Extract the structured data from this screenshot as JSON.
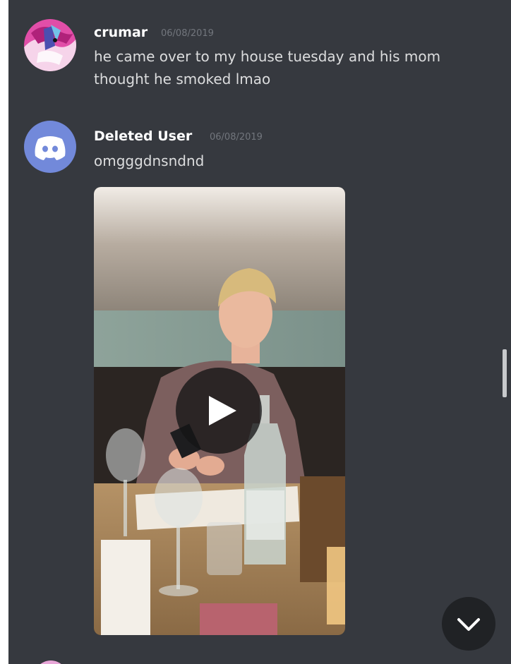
{
  "messages": [
    {
      "author": "crumar",
      "timestamp": "06/08/2019",
      "lines": [
        "he came over to my house tuesday and his mom",
        "thought he smoked lmao"
      ],
      "avatar": "artwork-avatar"
    },
    {
      "author": "Deleted User",
      "timestamp": "06/08/2019",
      "lines": [
        "omgggdnsndnd"
      ],
      "avatar": "discord-logo-avatar",
      "attachment": {
        "type": "video",
        "play_icon": "play-icon"
      }
    }
  ],
  "scroll_button": {
    "icon": "chevron-down-icon"
  },
  "colors": {
    "background": "#36393f",
    "author": "#ffffff",
    "text": "#dcddde",
    "timestamp": "#72767d",
    "discord_blurple": "#7289da"
  }
}
